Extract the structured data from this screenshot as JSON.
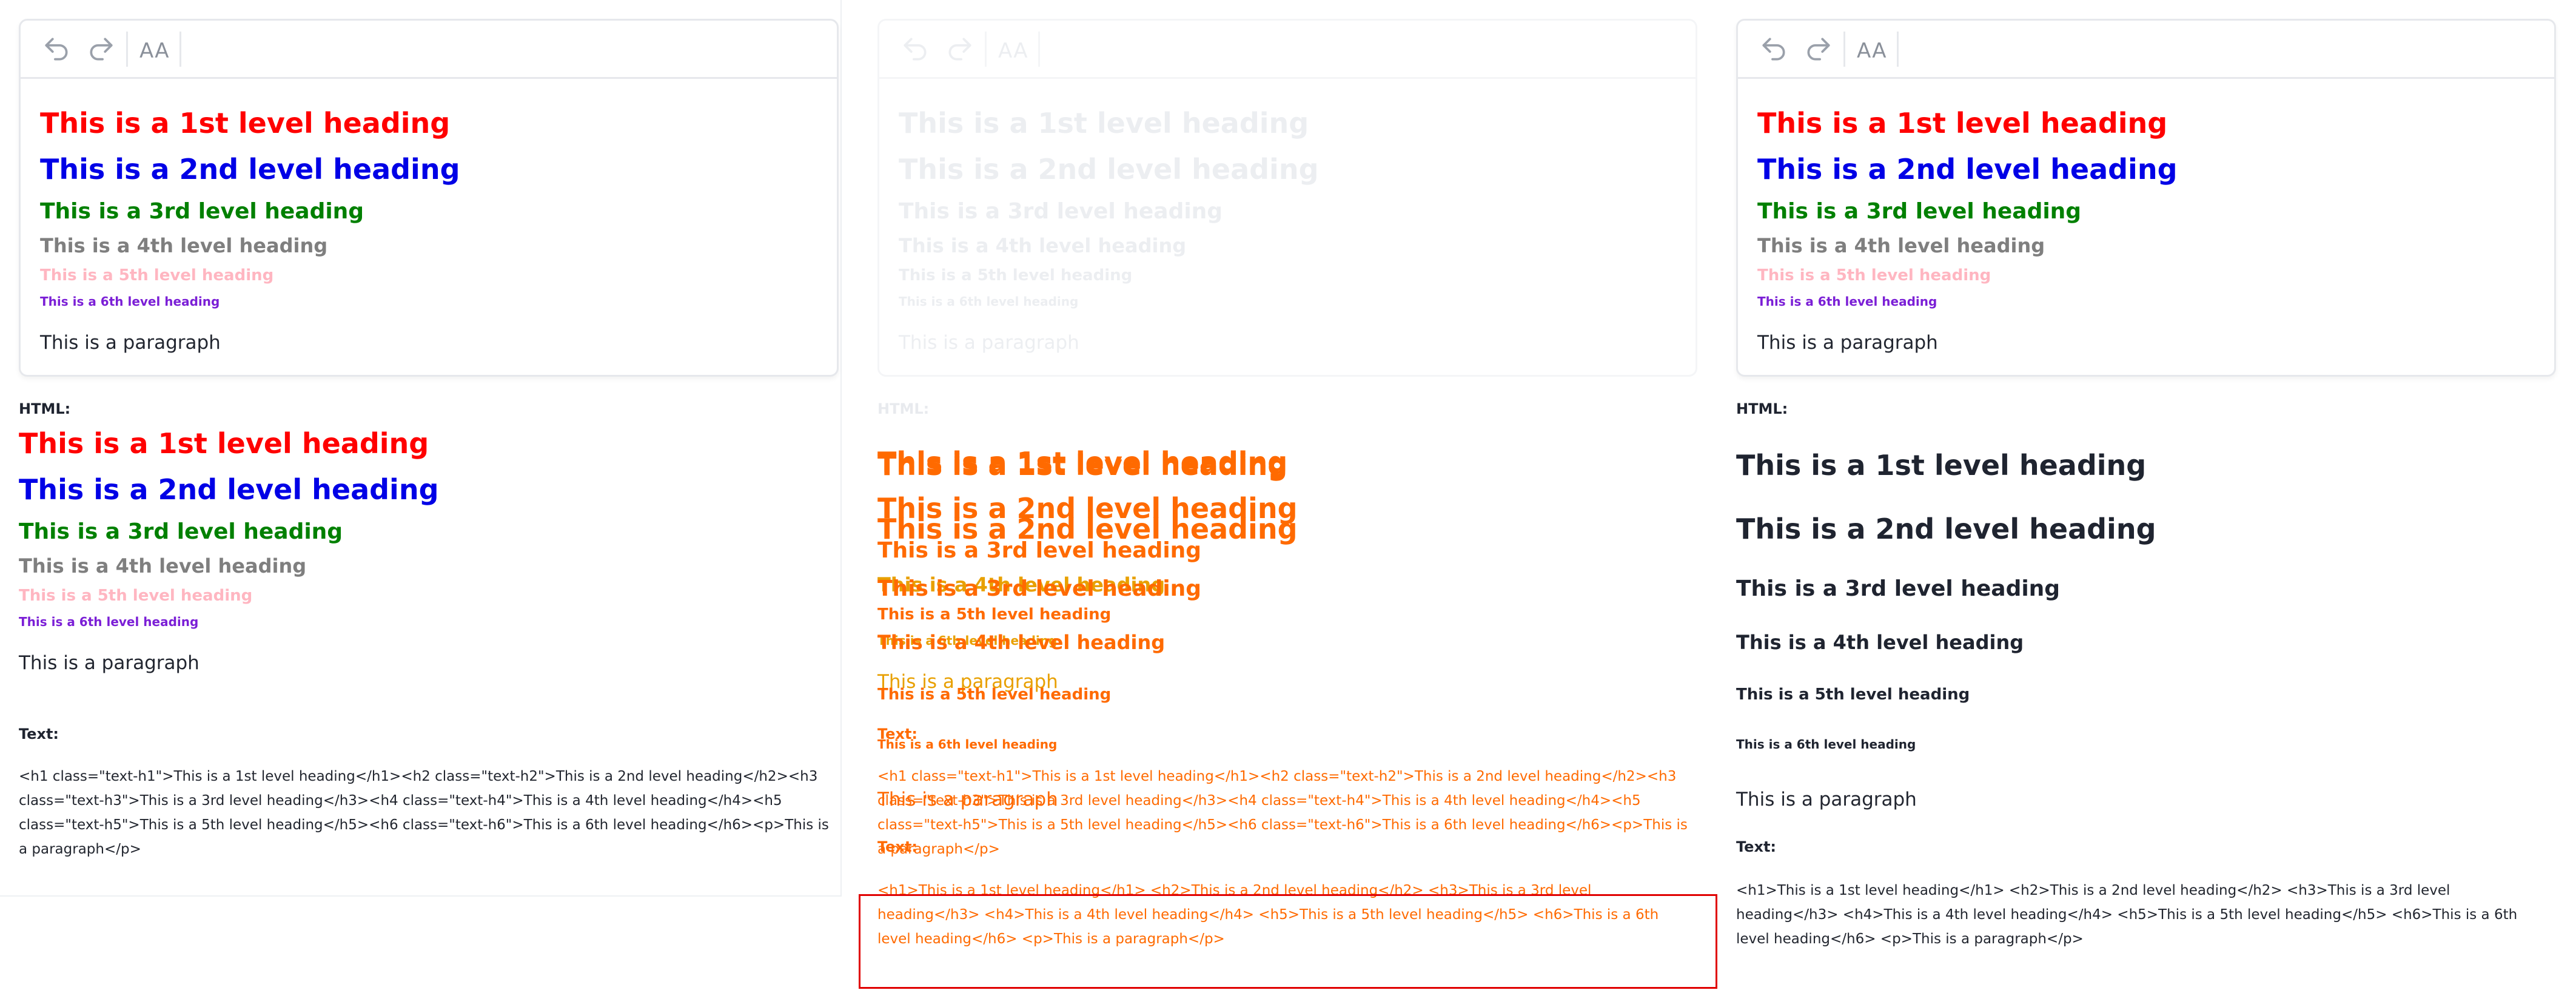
{
  "toolbar": {
    "aa_label": "AA"
  },
  "headings": {
    "h1": "This is a 1st level heading",
    "h2": "This is a 2nd level heading",
    "h3": "This is a 3rd level heading",
    "h4": "This is a 4th level heading",
    "h5": "This is a 5th level heading",
    "h6": "This is a 6th level heading",
    "p": "This is a paragraph"
  },
  "labels": {
    "html": "HTML:",
    "text": "Text:"
  },
  "code": {
    "classed": "<h1 class=\"text-h1\">This is a 1st level heading</h1><h2 class=\"text-h2\">This is a 2nd level heading</h2><h3 class=\"text-h3\">This is a 3rd level heading</h3><h4 class=\"text-h4\">This is a 4th level heading</h4><h5 class=\"text-h5\">This is a 5th level heading</h5><h6 class=\"text-h6\">This is a 6th level heading</h6><p>This is a paragraph</p>",
    "plain": "<h1>This is a 1st level heading</h1> <h2>This is a 2nd level heading</h2> <h3>This is a 3rd level heading</h3> <h4>This is a 4th level heading</h4> <h5>This is a 5th level heading</h5> <h6>This is a 6th level heading</h6> <p>This is a paragraph</p>"
  },
  "colors": {
    "h1": "#ff0000",
    "h2": "#0000e6",
    "h3": "#008000",
    "h4": "#7f7f7f",
    "h5": "#ffb6c1",
    "h6": "#7b1fd6",
    "diff_overlay": "#ff6a00",
    "diff_border": "#e00000"
  },
  "icons": [
    "undo-icon",
    "redo-icon",
    "font-size-icon"
  ]
}
